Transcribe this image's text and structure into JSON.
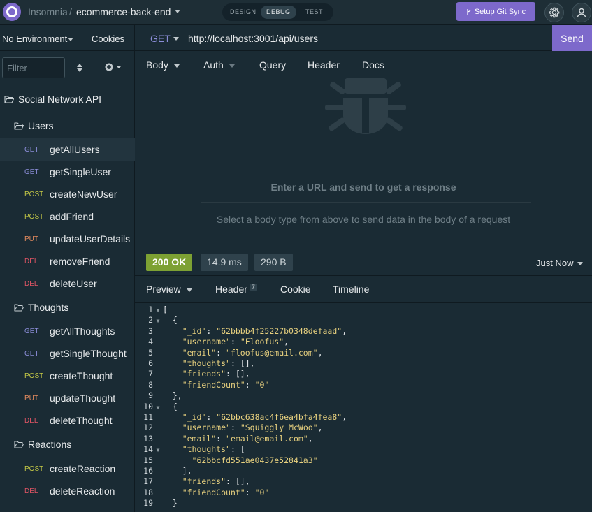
{
  "topbar": {
    "app_name": "Insomnia",
    "separator": "/",
    "project": "ecommerce-back-end",
    "modes": [
      "DESIGN",
      "DEBUG",
      "TEST"
    ],
    "active_mode": "DEBUG",
    "git_sync_label": "Setup Git Sync"
  },
  "sidebar": {
    "environment": "No Environment",
    "cookies": "Cookies",
    "filter_placeholder": "Filter",
    "tree": [
      {
        "type": "folder",
        "label": "Social Network API"
      },
      {
        "type": "folder",
        "label": "Users"
      },
      {
        "type": "request",
        "method": "GET",
        "label": "getAllUsers",
        "selected": true
      },
      {
        "type": "request",
        "method": "GET",
        "label": "getSingleUser"
      },
      {
        "type": "request",
        "method": "POST",
        "label": "createNewUser"
      },
      {
        "type": "request",
        "method": "POST",
        "label": "addFriend"
      },
      {
        "type": "request",
        "method": "PUT",
        "label": "updateUserDetails"
      },
      {
        "type": "request",
        "method": "DEL",
        "label": "removeFriend"
      },
      {
        "type": "request",
        "method": "DEL",
        "label": "deleteUser"
      },
      {
        "type": "folder",
        "label": "Thoughts"
      },
      {
        "type": "request",
        "method": "GET",
        "label": "getAllThoughts"
      },
      {
        "type": "request",
        "method": "GET",
        "label": "getSingleThought"
      },
      {
        "type": "request",
        "method": "POST",
        "label": "createThought"
      },
      {
        "type": "request",
        "method": "PUT",
        "label": "updateThought"
      },
      {
        "type": "request",
        "method": "DEL",
        "label": "deleteThought"
      },
      {
        "type": "folder",
        "label": "Reactions"
      },
      {
        "type": "request",
        "method": "POST",
        "label": "createReaction"
      },
      {
        "type": "request",
        "method": "DEL",
        "label": "deleteReaction"
      }
    ]
  },
  "request": {
    "method": "GET",
    "url": "http://localhost:3001/api/users",
    "send_label": "Send",
    "tabs": {
      "body": "Body",
      "auth": "Auth",
      "query": "Query",
      "header": "Header",
      "docs": "Docs"
    },
    "empty_title": "Enter a URL and send to get a response",
    "empty_sub": "Select a body type from above to send data in the body of a request"
  },
  "response": {
    "status": "200 OK",
    "time": "14.9 ms",
    "size": "290 B",
    "history": "Just Now",
    "tabs": {
      "preview": "Preview",
      "header": "Header",
      "header_count": "7",
      "cookie": "Cookie",
      "timeline": "Timeline"
    },
    "lines": [
      {
        "n": "1",
        "fold": true,
        "text": "["
      },
      {
        "n": "2",
        "fold": true,
        "text": "  {"
      },
      {
        "n": "3",
        "text": "    \"_id\": \"62bbbb4f25227b0348defaad\","
      },
      {
        "n": "4",
        "text": "    \"username\": \"Floofus\","
      },
      {
        "n": "5",
        "text": "    \"email\": \"floofus@email.com\","
      },
      {
        "n": "6",
        "text": "    \"thoughts\": [],"
      },
      {
        "n": "7",
        "text": "    \"friends\": [],"
      },
      {
        "n": "8",
        "text": "    \"friendCount\": \"0\""
      },
      {
        "n": "9",
        "text": "  },"
      },
      {
        "n": "10",
        "fold": true,
        "text": "  {"
      },
      {
        "n": "11",
        "text": "    \"_id\": \"62bbc638ac4f6ea4bfa4fea8\","
      },
      {
        "n": "12",
        "text": "    \"username\": \"Squiggly McWoo\","
      },
      {
        "n": "13",
        "text": "    \"email\": \"email@email.com\","
      },
      {
        "n": "14",
        "fold": true,
        "text": "    \"thoughts\": ["
      },
      {
        "n": "15",
        "text": "      \"62bbcfd551ae0437e52841a3\""
      },
      {
        "n": "16",
        "text": "    ],"
      },
      {
        "n": "17",
        "text": "    \"friends\": [],"
      },
      {
        "n": "18",
        "text": "    \"friendCount\": \"0\""
      },
      {
        "n": "19",
        "text": "  }"
      }
    ]
  },
  "colors": {
    "accent": "#7d69cb",
    "get": "#8b8dd8",
    "post": "#c4c846",
    "put": "#e68c5f",
    "del": "#e05565",
    "ok": "#7da133"
  }
}
